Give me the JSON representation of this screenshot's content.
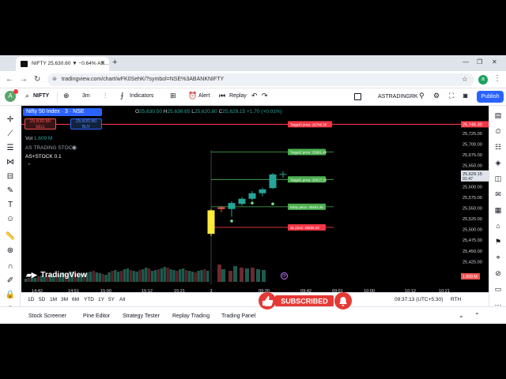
{
  "browser": {
    "tab_title": "NIFTY 25,630.60 ▼ −0.64% AS...",
    "url": "tradingview.com/chart/wFK0SehK/?symbol=NSE%3ABANKNIFTY",
    "profile_initial": "a"
  },
  "toolbar": {
    "avatar_letter": "A",
    "search_symbol": "NIFTY",
    "interval": "3m",
    "indicators_label": "Indicators",
    "alert_label": "Alert",
    "replay_label": "Replay",
    "account_name": "ASTRADINGRK",
    "publish_label": "Publish"
  },
  "legend": {
    "symbol_title": "Nifty 50 Index · 3 · NSE",
    "ohlc": {
      "o_label": "O",
      "o": "25,630.50",
      "h_label": "H",
      "h": "25,636.65",
      "l_label": "L",
      "l": "25,620.80",
      "c_label": "C",
      "c": "25,629.15",
      "change": "+1.70 (+0.01%)"
    },
    "sell_price": "25,630.60",
    "sell_label": "SELL",
    "buy_price": "25,630.60",
    "buy_label": "BUY",
    "vol_label": "Vol",
    "vol_value": "1.609 M",
    "indicator1": "AS TRADING STOCK",
    "indicator2": "AS+STOCK 0.1"
  },
  "watermark": "TradingView",
  "chart_data": {
    "type": "candlestick",
    "ylim": [
      25420,
      25760
    ],
    "price_ticks": [
      "25,725.00",
      "25,700.00",
      "25,675.00",
      "25,650.00",
      "25,600.00",
      "25,575.00",
      "25,550.00",
      "25,525.00",
      "25,500.00",
      "25,475.00",
      "25,450.00",
      "25,425.00"
    ],
    "time_ticks": [
      "14:42",
      "14:51",
      "15:00",
      "15:12",
      "15:21",
      "3",
      "09:30",
      "09:42",
      "09:51",
      "10:00",
      "10:12",
      "10:21"
    ],
    "current_price_label": "25,629.15",
    "current_countdown": "01:47",
    "top_price_label": "25,746.30",
    "volume_label": "1.609 M",
    "candles": [
      {
        "o": 25545,
        "h": 25548,
        "l": 25485,
        "c": 25490,
        "color": "yellow"
      },
      {
        "o": 25552,
        "h": 25555,
        "l": 25540,
        "c": 25548,
        "color": "red"
      },
      {
        "o": 25548,
        "h": 25566,
        "l": 25530,
        "c": 25562,
        "color": "green"
      },
      {
        "o": 25560,
        "h": 25576,
        "l": 25556,
        "c": 25572,
        "color": "green"
      },
      {
        "o": 25572,
        "h": 25590,
        "l": 25568,
        "c": 25585,
        "color": "green"
      },
      {
        "o": 25585,
        "h": 25598,
        "l": 25578,
        "c": 25594,
        "color": "green"
      },
      {
        "o": 25597,
        "h": 25632,
        "l": 25595,
        "c": 25629,
        "color": "green"
      },
      {
        "o": 25630,
        "h": 25637,
        "l": 25621,
        "c": 25629,
        "color": "green"
      }
    ],
    "levels": [
      {
        "label": "Target3 price: 25746.30",
        "price": 25746.3,
        "color": "#f23645"
      },
      {
        "label": "Target2 price: 25681.40",
        "price": 25681.4,
        "color": "#4caf50"
      },
      {
        "label": "Target1 price: 25617.15",
        "price": 25617.15,
        "color": "#4caf50"
      },
      {
        "label": "Entry price: 25553.25",
        "price": 25553.25,
        "color": "#4caf50"
      },
      {
        "label": "SL price: 25505.10",
        "price": 25505.1,
        "color": "#f23645"
      }
    ]
  },
  "range_bar": {
    "ranges": [
      "1D",
      "5D",
      "1M",
      "3M",
      "6M",
      "YTD",
      "1Y",
      "5Y",
      "All"
    ],
    "clock": "09:37:13 (UTC+5:30)",
    "session": "RTH"
  },
  "bottom_tabs": [
    "Stock Screener",
    "Pine Editor",
    "Strategy Tester",
    "Replay Trading",
    "Trading Panel"
  ],
  "overlay": {
    "subscribe_label": "SUBSCRIBED"
  },
  "colors": {
    "green": "#26a69a",
    "red": "#ef5350",
    "accent": "#2962ff",
    "subscribe": "#e53935",
    "yellow": "#ffeb3b"
  }
}
